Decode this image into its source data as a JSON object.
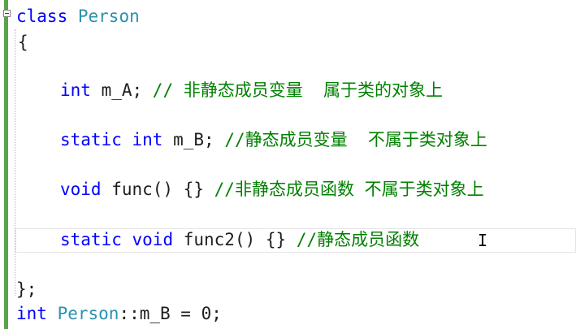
{
  "colors": {
    "keyword": "#0000ff",
    "type_name": "#2b91af",
    "comment": "#008000",
    "text": "#1e1e1e",
    "gutter_change": "#57a64a"
  },
  "cursor_icon": "text-cursor-icon",
  "lines": {
    "l1": {
      "kw": "class",
      "type": "Person"
    },
    "l2": {
      "text": "{"
    },
    "l3": {
      "kw": "int",
      "code": " m_A; ",
      "comment": "// 非静态成员变量  属于类的对象上"
    },
    "l4": {
      "kw1": "static",
      "kw2": "int",
      "code": " m_B; ",
      "comment": "//静态成员变量  不属于类对象上"
    },
    "l5": {
      "kw": "void",
      "code": " func() {} ",
      "comment": "//非静态成员函数 不属于类对象上"
    },
    "l6": {
      "kw1": "static",
      "kw2": "void",
      "code": " func2() {} ",
      "comment": "//静态成员函数"
    },
    "l7": {
      "text": "};"
    },
    "l8": {
      "kw": "int",
      "type": "Person",
      "code": "::m_B = 0;"
    }
  }
}
